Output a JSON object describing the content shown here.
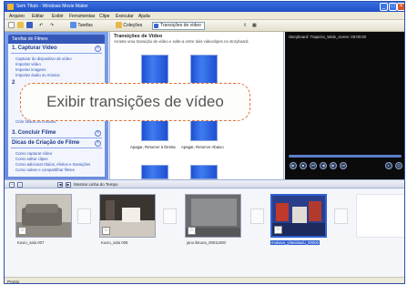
{
  "window": {
    "title": "Sem Título - Windows Movie Maker",
    "buttons": [
      "_",
      "□",
      "×"
    ]
  },
  "menu": [
    "Arquivo",
    "Editar",
    "Exibir",
    "Ferramentas",
    "Clipe",
    "Executar",
    "Ajuda"
  ],
  "toolbar": {
    "tasks_label": "Tarefas",
    "collections_label": "Coleções",
    "selected_collection": "Transições de vídeo"
  },
  "tasks_panel": {
    "header": "Tarefas de Filmes",
    "capture": {
      "title": "1. Capturar Vídeo",
      "links": [
        "Capturar do dispositivo de vídeo",
        "Importar vídeo",
        "Importar imagens",
        "Importar áudio ou música"
      ]
    },
    "edit": {
      "title": "2",
      "links": [
        "Criar títulos ou créditos"
      ]
    },
    "finish": {
      "title": "3. Concluir Filme"
    },
    "tips": {
      "title": "Dicas de Criação de Filme",
      "links": [
        "Como capturar vídeo",
        "Como editar clipes",
        "Como adicionar títulos, efeitos e transições",
        "Como salvar e compartilhar filmes"
      ]
    }
  },
  "collection": {
    "title": "Transições de Vídeo",
    "subtitle": "Arraste uma transição de vídeo e solte-a entre dois videoclipes no storyboard.",
    "items": [
      {
        "label": "Apagar, Retorcer à Direita"
      },
      {
        "label": "Apagar, Retorcer Abaixo"
      }
    ]
  },
  "callout": {
    "text": "Exibir transições de vídeo"
  },
  "player": {
    "caption": "Storyboard: Trapezio_Wide_scene: 00:00:00"
  },
  "storyboard_toolbar": {
    "show_timeline_label": "Mostrar Linha do Tempo"
  },
  "clips": [
    {
      "label": "Kuvio_sala 007"
    },
    {
      "label": "Kuvio_sala 008"
    },
    {
      "label": "jano ikkuna_00011000"
    },
    {
      "label": "mukava_yhteislaulu_00000"
    }
  ],
  "status": {
    "text": "Pronto"
  }
}
